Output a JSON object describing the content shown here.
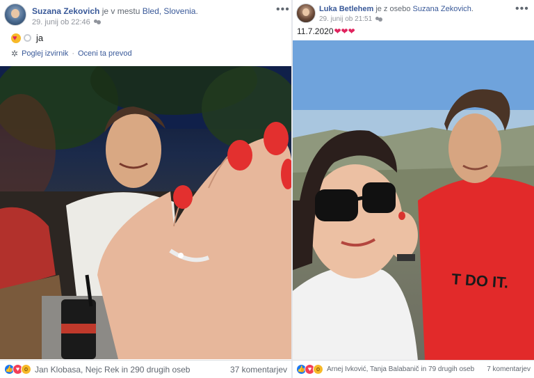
{
  "left_post": {
    "author": "Suzana Zekovich",
    "location_prefix": "je v mestu",
    "location": "Bled, Slovenia",
    "location_suffix": ".",
    "timestamp": "29. junij ob 22:46",
    "more_icon": "ellipsis-icon",
    "text": "ja",
    "emojis": [
      "smiling-face-with-hearts-icon",
      "ring-icon"
    ],
    "translate_links": {
      "original": "Poglej izvirnik",
      "separator": "·",
      "rate": "Oceni ta prevod"
    },
    "photo_description_icon": "photo",
    "reactions": [
      "like",
      "love",
      "wow"
    ],
    "reaction_summary": "Jan Klobasa, Nejc Rek in 290 drugih oseb",
    "comments": "37 komentarjev"
  },
  "right_post": {
    "author": "Luka Betlehem",
    "with_prefix": "je z osebo",
    "with_person": "Suzana Zekovich",
    "with_suffix": ".",
    "timestamp": "29. junij ob 21:51",
    "more_icon": "ellipsis-icon",
    "text": "11.7.2020",
    "hearts": "❤❤❤",
    "reactions": [
      "like",
      "love",
      "wow"
    ],
    "reaction_summary": "Arnej Ivković, Tanja Balabanič in 79 drugih oseb",
    "comments": "7 komentarjev"
  },
  "colors": {
    "link": "#385898",
    "like": "#1877f2",
    "love": "#f33e58",
    "wow": "#f7b928"
  }
}
